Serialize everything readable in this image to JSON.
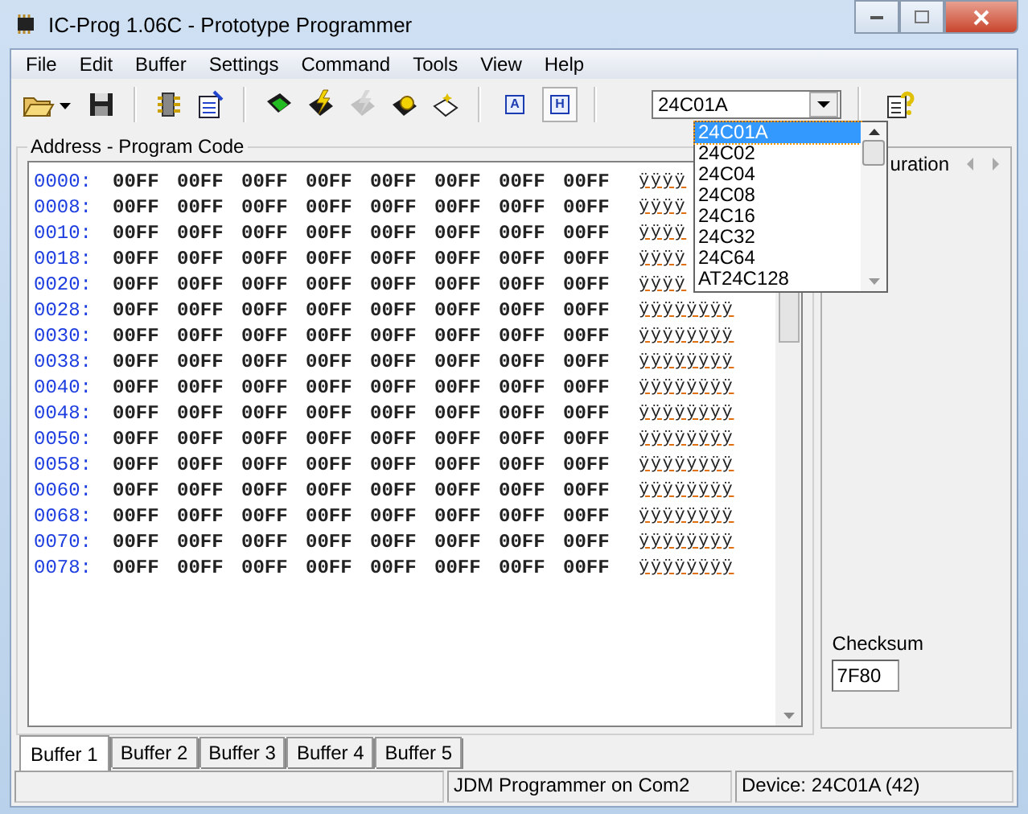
{
  "window": {
    "title": "IC-Prog 1.06C - Prototype Programmer"
  },
  "menu": [
    "File",
    "Edit",
    "Buffer",
    "Settings",
    "Command",
    "Tools",
    "View",
    "Help"
  ],
  "toolbar": [
    {
      "kind": "open",
      "disabled": false
    },
    {
      "kind": "save",
      "disabled": false
    },
    {
      "kind": "sep"
    },
    {
      "kind": "chip",
      "disabled": false
    },
    {
      "kind": "config",
      "disabled": false
    },
    {
      "kind": "sep"
    },
    {
      "kind": "read",
      "disabled": false
    },
    {
      "kind": "program",
      "disabled": false
    },
    {
      "kind": "erase",
      "disabled": true
    },
    {
      "kind": "verify",
      "disabled": false
    },
    {
      "kind": "blank",
      "disabled": false
    },
    {
      "kind": "sep"
    },
    {
      "kind": "view",
      "label": "A",
      "selected": false
    },
    {
      "kind": "view",
      "label": "H",
      "selected": true
    },
    {
      "kind": "sep"
    }
  ],
  "device_select": {
    "value": "24C01A",
    "options": [
      {
        "label": "24C01A",
        "selected": true
      },
      {
        "label": "24C02",
        "selected": false
      },
      {
        "label": "24C04",
        "selected": false
      },
      {
        "label": "24C08",
        "selected": false
      },
      {
        "label": "24C16",
        "selected": false
      },
      {
        "label": "24C32",
        "selected": false
      },
      {
        "label": "24C64",
        "selected": false
      },
      {
        "label": "AT24C128",
        "selected": false
      }
    ]
  },
  "code_panel": {
    "title": "Address - Program Code",
    "rows": [
      {
        "address": "0000:",
        "words": [
          "00FF",
          "00FF",
          "00FF",
          "00FF",
          "00FF",
          "00FF",
          "00FF",
          "00FF"
        ],
        "ascii": "ÿÿÿÿ"
      },
      {
        "address": "0008:",
        "words": [
          "00FF",
          "00FF",
          "00FF",
          "00FF",
          "00FF",
          "00FF",
          "00FF",
          "00FF"
        ],
        "ascii": "ÿÿÿÿ"
      },
      {
        "address": "0010:",
        "words": [
          "00FF",
          "00FF",
          "00FF",
          "00FF",
          "00FF",
          "00FF",
          "00FF",
          "00FF"
        ],
        "ascii": "ÿÿÿÿ"
      },
      {
        "address": "0018:",
        "words": [
          "00FF",
          "00FF",
          "00FF",
          "00FF",
          "00FF",
          "00FF",
          "00FF",
          "00FF"
        ],
        "ascii": "ÿÿÿÿ"
      },
      {
        "address": "0020:",
        "words": [
          "00FF",
          "00FF",
          "00FF",
          "00FF",
          "00FF",
          "00FF",
          "00FF",
          "00FF"
        ],
        "ascii": "ÿÿÿÿ"
      },
      {
        "address": "0028:",
        "words": [
          "00FF",
          "00FF",
          "00FF",
          "00FF",
          "00FF",
          "00FF",
          "00FF",
          "00FF"
        ],
        "ascii": "ÿÿÿÿÿÿÿÿ"
      },
      {
        "address": "0030:",
        "words": [
          "00FF",
          "00FF",
          "00FF",
          "00FF",
          "00FF",
          "00FF",
          "00FF",
          "00FF"
        ],
        "ascii": "ÿÿÿÿÿÿÿÿ"
      },
      {
        "address": "0038:",
        "words": [
          "00FF",
          "00FF",
          "00FF",
          "00FF",
          "00FF",
          "00FF",
          "00FF",
          "00FF"
        ],
        "ascii": "ÿÿÿÿÿÿÿÿ"
      },
      {
        "address": "0040:",
        "words": [
          "00FF",
          "00FF",
          "00FF",
          "00FF",
          "00FF",
          "00FF",
          "00FF",
          "00FF"
        ],
        "ascii": "ÿÿÿÿÿÿÿÿ"
      },
      {
        "address": "0048:",
        "words": [
          "00FF",
          "00FF",
          "00FF",
          "00FF",
          "00FF",
          "00FF",
          "00FF",
          "00FF"
        ],
        "ascii": "ÿÿÿÿÿÿÿÿ"
      },
      {
        "address": "0050:",
        "words": [
          "00FF",
          "00FF",
          "00FF",
          "00FF",
          "00FF",
          "00FF",
          "00FF",
          "00FF"
        ],
        "ascii": "ÿÿÿÿÿÿÿÿ"
      },
      {
        "address": "0058:",
        "words": [
          "00FF",
          "00FF",
          "00FF",
          "00FF",
          "00FF",
          "00FF",
          "00FF",
          "00FF"
        ],
        "ascii": "ÿÿÿÿÿÿÿÿ"
      },
      {
        "address": "0060:",
        "words": [
          "00FF",
          "00FF",
          "00FF",
          "00FF",
          "00FF",
          "00FF",
          "00FF",
          "00FF"
        ],
        "ascii": "ÿÿÿÿÿÿÿÿ"
      },
      {
        "address": "0068:",
        "words": [
          "00FF",
          "00FF",
          "00FF",
          "00FF",
          "00FF",
          "00FF",
          "00FF",
          "00FF"
        ],
        "ascii": "ÿÿÿÿÿÿÿÿ"
      },
      {
        "address": "0070:",
        "words": [
          "00FF",
          "00FF",
          "00FF",
          "00FF",
          "00FF",
          "00FF",
          "00FF",
          "00FF"
        ],
        "ascii": "ÿÿÿÿÿÿÿÿ"
      },
      {
        "address": "0078:",
        "words": [
          "00FF",
          "00FF",
          "00FF",
          "00FF",
          "00FF",
          "00FF",
          "00FF",
          "00FF"
        ],
        "ascii": "ÿÿÿÿÿÿÿÿ"
      }
    ]
  },
  "config_panel": {
    "title": "uration",
    "checksum_label": "Checksum",
    "checksum": "7F80"
  },
  "buffer_tabs": [
    {
      "label": "Buffer 1",
      "selected": true
    },
    {
      "label": "Buffer 2",
      "selected": false
    },
    {
      "label": "Buffer 3",
      "selected": false
    },
    {
      "label": "Buffer 4",
      "selected": false
    },
    {
      "label": "Buffer 5",
      "selected": false
    }
  ],
  "status_bar": {
    "programmer": "JDM Programmer on Com2",
    "device": "Device: 24C01A  (42)"
  }
}
